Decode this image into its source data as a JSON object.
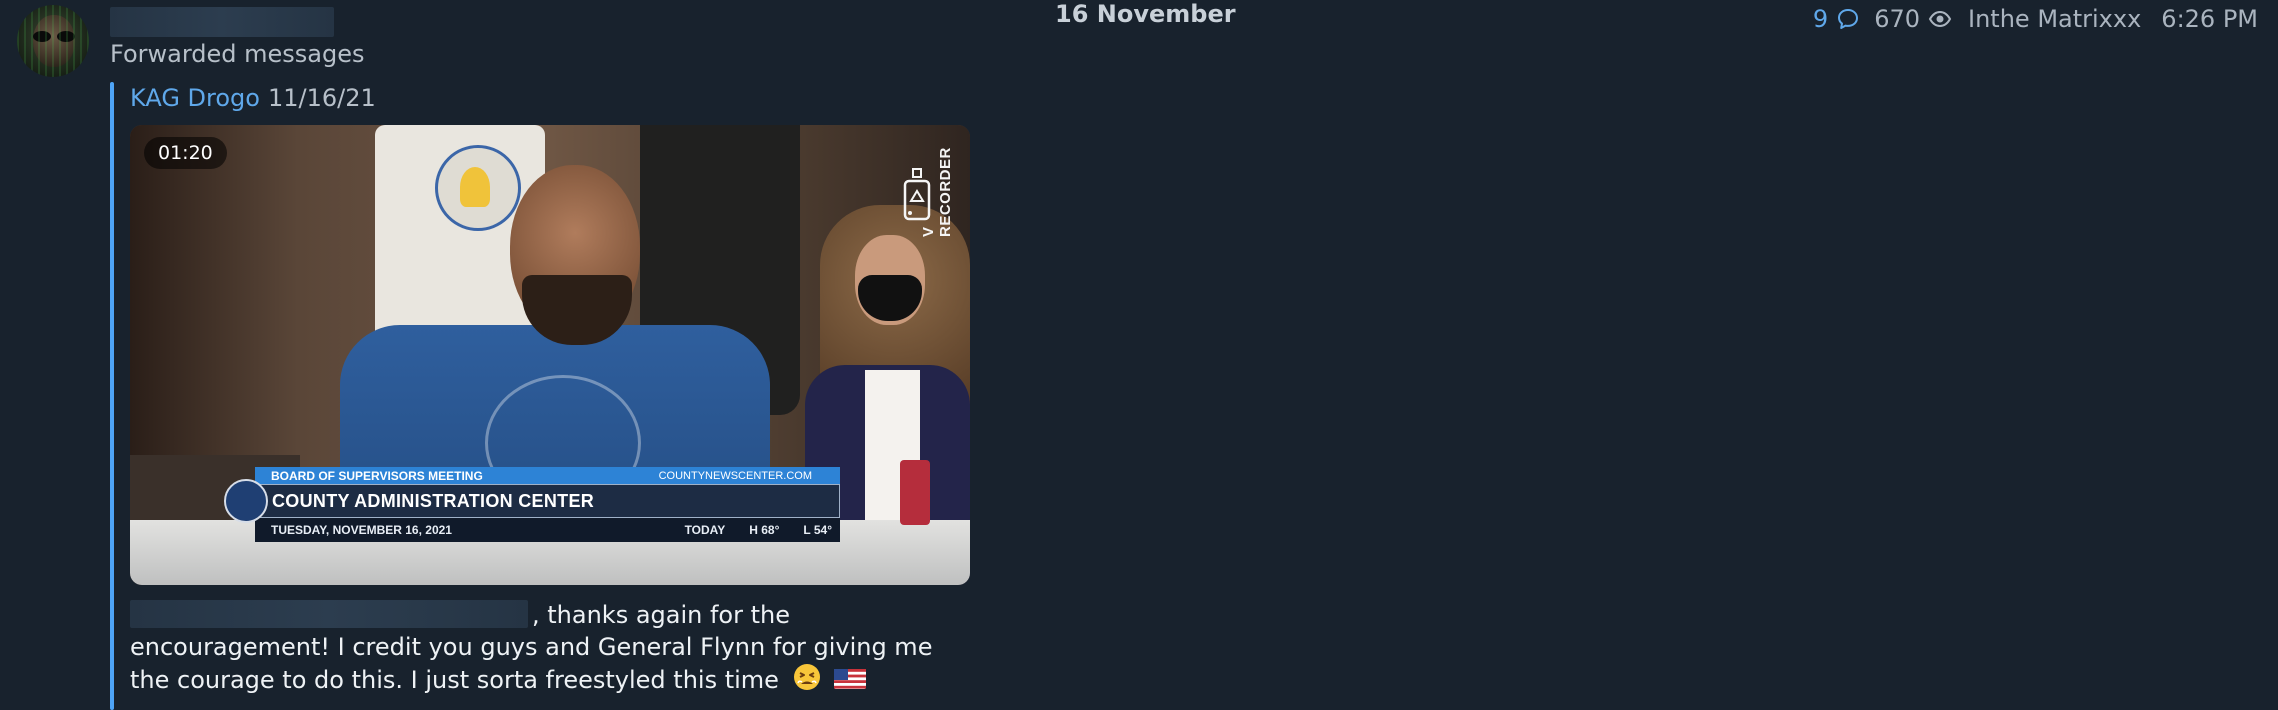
{
  "header": {
    "forwarded_label": "Forwarded messages",
    "date": "16 November"
  },
  "meta": {
    "reply_count": "9",
    "views": "670",
    "channel": "Inthe Matrixxx",
    "time": "6:26 PM",
    "accent_color": "#5fa8ea"
  },
  "forward": {
    "author": "KAG Drogo",
    "date": "11/16/21"
  },
  "video": {
    "duration": "01:20",
    "lower_third": {
      "top_left": "BOARD OF SUPERVISORS MEETING",
      "top_right": "COUNTYNEWSCENTER.COM",
      "title": "COUNTY ADMINISTRATION CENTER",
      "date": "TUESDAY, NOVEMBER 16, 2021",
      "today": "TODAY",
      "high": "H 68°",
      "low": "L 54°"
    },
    "watermark": "V RECORDER"
  },
  "caption": {
    "line1": ", thanks again for the",
    "rest": "encouragement! I credit you guys and General Flynn for giving me the courage to do this. I just sorta freestyled this time",
    "emojis": [
      "persevering-face",
      "us-flag"
    ]
  }
}
